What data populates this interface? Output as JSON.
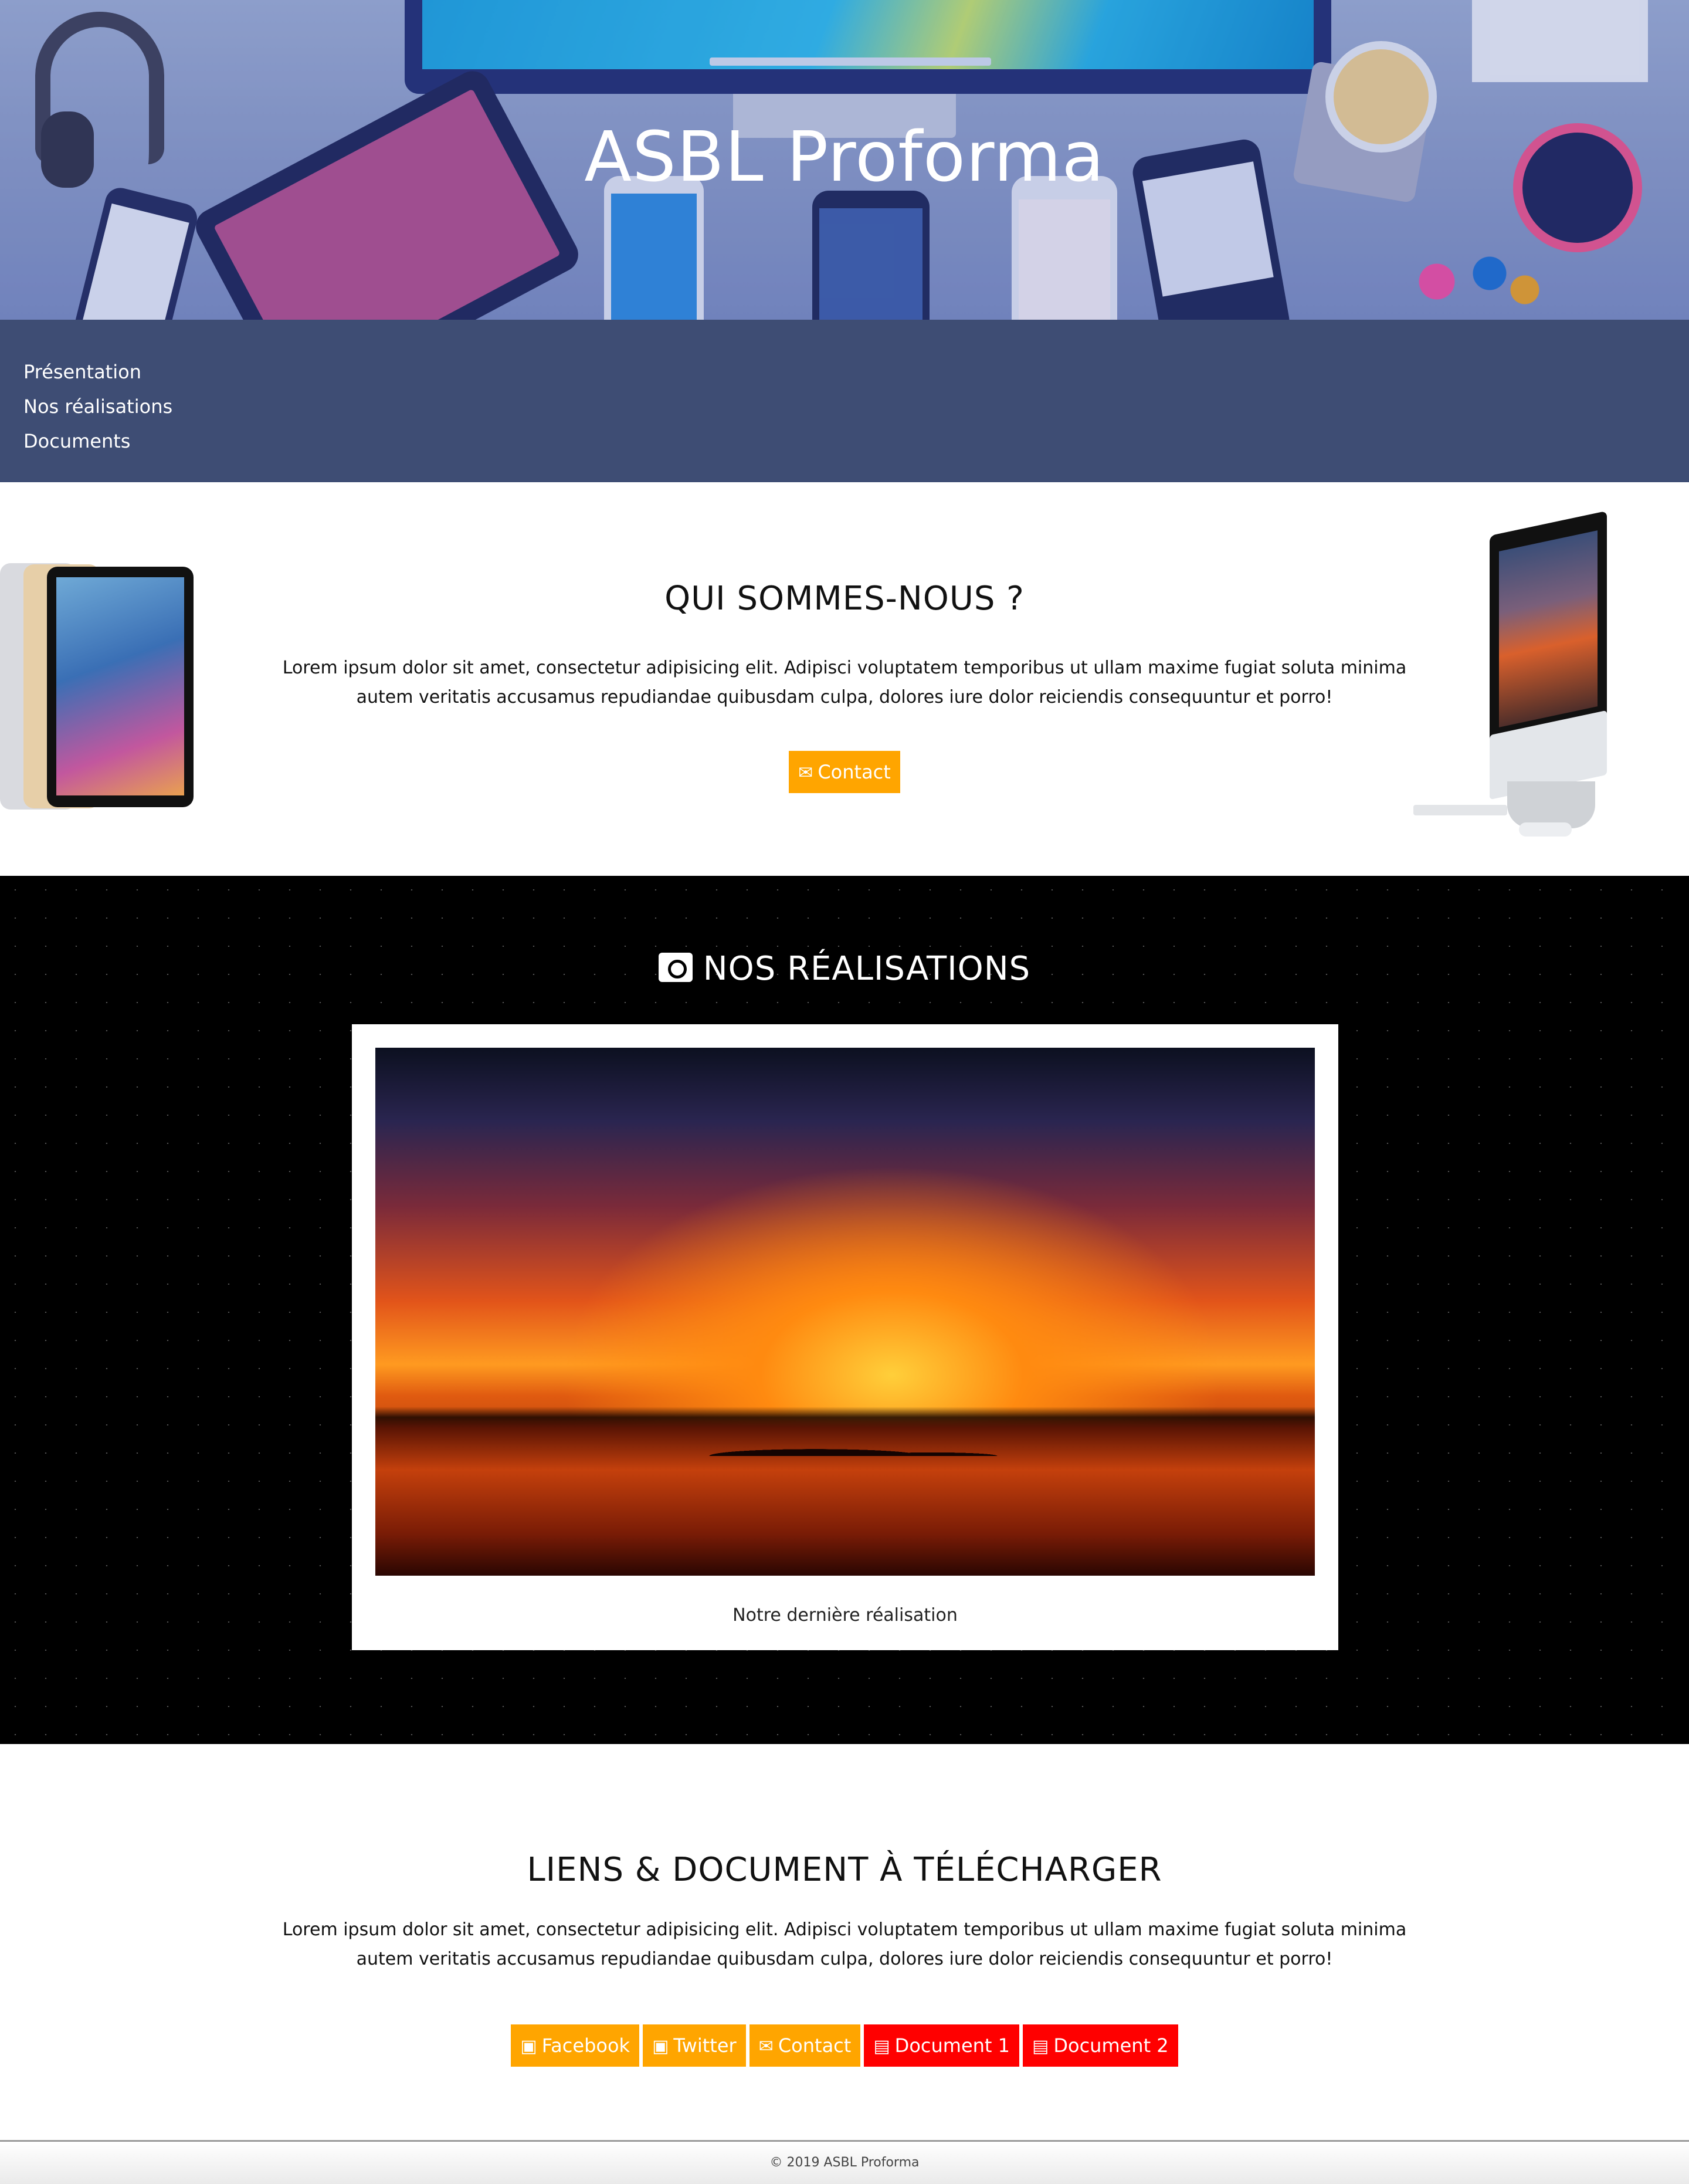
{
  "hero": {
    "title": "ASBL Proforma"
  },
  "nav": {
    "items": [
      "Présentation",
      "Nos réalisations",
      "Documents"
    ]
  },
  "about": {
    "title": "QUI SOMMES-NOUS ?",
    "text": "Lorem ipsum dolor sit amet, consectetur adipisicing elit. Adipisci voluptatem temporibus ut ullam maxime fugiat soluta minima autem veritatis accusamus repudiandae quibusdam culpa, dolores iure dolor reiciendis consequuntur et porro!",
    "contact_label": "Contact",
    "contact_icon": "envelope-icon"
  },
  "realisations": {
    "title": "NOS RÉALISATIONS",
    "title_icon": "camera-icon",
    "caption": "Notre dernière réalisation"
  },
  "links": {
    "title": "LIENS & DOCUMENT À TÉLÉCHARGER",
    "text": "Lorem ipsum dolor sit amet, consectetur adipisicing elit. Adipisci voluptatem temporibus ut ullam maxime fugiat soluta minima autem veritatis accusamus repudiandae quibusdam culpa, dolores iure dolor reiciendis consequuntur et porro!",
    "buttons": [
      {
        "label": "Facebook",
        "icon": "facebook-icon",
        "color": "#ffa500"
      },
      {
        "label": "Twitter",
        "icon": "twitter-icon",
        "color": "#ffa500"
      },
      {
        "label": "Contact",
        "icon": "envelope-icon",
        "color": "#ffa500"
      },
      {
        "label": "Document 1",
        "icon": "file-icon",
        "color": "#ff0000"
      },
      {
        "label": "Document 2",
        "icon": "file-icon",
        "color": "#ff0000"
      }
    ]
  },
  "footer": {
    "text": "© 2019 ASBL Proforma"
  },
  "colors": {
    "nav_bg": "#3e4d74",
    "accent_orange": "#ffa500",
    "accent_red": "#ff0000"
  }
}
